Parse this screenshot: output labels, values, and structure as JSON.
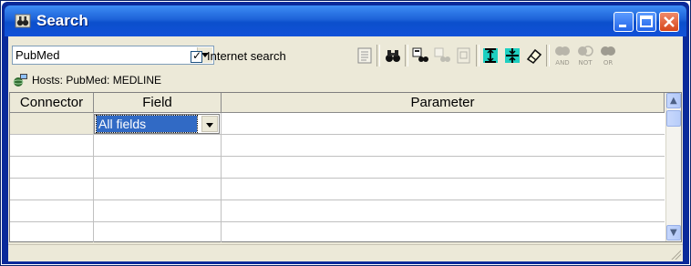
{
  "window": {
    "title": "Search"
  },
  "toolbar": {
    "database": "PubMed",
    "internet_search_checked": true,
    "internet_search_label": "Internet search",
    "tools": [
      "notes-icon",
      "binoculars-icon",
      "copy-records-icon",
      "paste-records-icon",
      "document-icon",
      "insert-row-icon",
      "delete-row-icon",
      "eraser-icon"
    ],
    "logic": [
      "AND",
      "NOT",
      "OR"
    ]
  },
  "hosts": {
    "text": "Hosts: PubMed: MEDLINE"
  },
  "grid": {
    "columns": [
      "Connector",
      "Field",
      "Parameter"
    ],
    "field_value": "All fields",
    "row_count": 6
  }
}
